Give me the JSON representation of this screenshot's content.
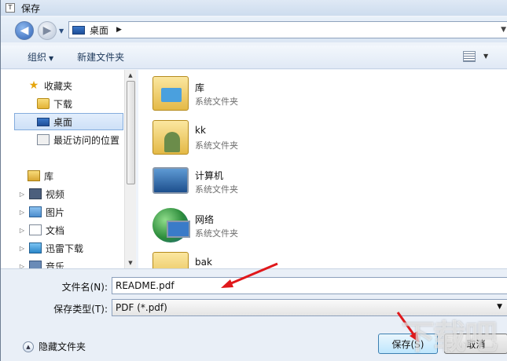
{
  "window": {
    "title": "保存",
    "app_icon_letter": "T"
  },
  "address": {
    "location": "桌面"
  },
  "toolbar": {
    "organize": "组织",
    "new_folder": "新建文件夹"
  },
  "nav": {
    "favorites": "收藏夹",
    "downloads": "下载",
    "desktop": "桌面",
    "recent": "最近访问的位置",
    "libraries": "库",
    "videos": "视频",
    "pictures": "图片",
    "documents": "文档",
    "xunlei": "迅雷下载",
    "music": "音乐"
  },
  "files": [
    {
      "name": "库",
      "type": "系统文件夹",
      "icon": "library-icon"
    },
    {
      "name": "kk",
      "type": "系统文件夹",
      "icon": "user-folder-icon"
    },
    {
      "name": "计算机",
      "type": "系统文件夹",
      "icon": "computer-icon"
    },
    {
      "name": "网络",
      "type": "系统文件夹",
      "icon": "network-icon"
    },
    {
      "name": "bak",
      "type": "",
      "icon": "folder-icon"
    }
  ],
  "form": {
    "filename_label": "文件名(N):",
    "filename_value": "README.pdf",
    "filetype_label": "保存类型(T):",
    "filetype_value": "PDF (*.pdf)",
    "hide_folders": "隐藏文件夹",
    "save_button": "保存(S)",
    "cancel_button": "取消"
  },
  "watermark": "下载吧"
}
